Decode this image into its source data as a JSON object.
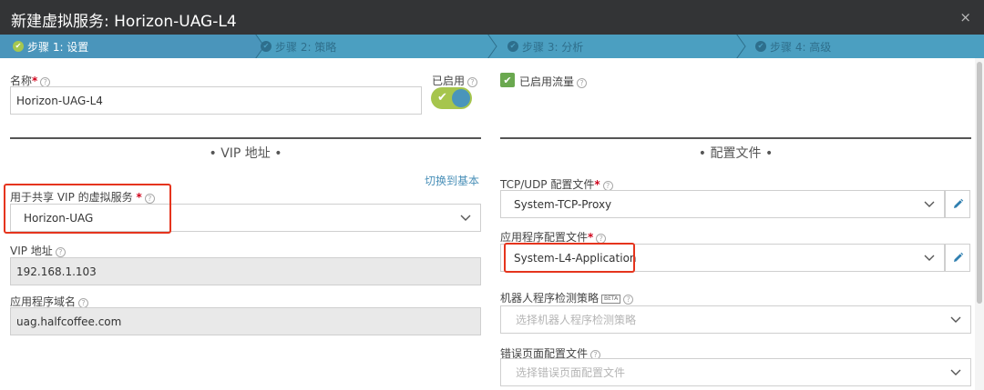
{
  "window": {
    "title": "新建虚拟服务: Horizon-UAG-L4",
    "close_glyph": "×"
  },
  "steps": [
    {
      "label": "步骤 1: 设置",
      "state": "active"
    },
    {
      "label": "步骤 2: 策略",
      "state": "inactive"
    },
    {
      "label": "步骤 3: 分析",
      "state": "inactive"
    },
    {
      "label": "步骤 4: 高级",
      "state": "inactive"
    }
  ],
  "left": {
    "name_label": "名称",
    "name_value": "Horizon-UAG-L4",
    "enabled_label": "已启用",
    "enabled": true,
    "vip_section_title": "• VIP 地址 •",
    "switch_link": "切换到基本",
    "shared_vip_label": "用于共享 VIP 的虚拟服务",
    "shared_vip_value": "Horizon-UAG",
    "vip_address_label": "VIP 地址",
    "vip_address_value": "192.168.1.103",
    "app_domain_label": "应用程序域名",
    "app_domain_value": "uag.halfcoffee.com"
  },
  "right": {
    "traffic_enabled_label": "已启用流量",
    "traffic_enabled": true,
    "profile_section_title": "• 配置文件 •",
    "tcp_udp_label": "TCP/UDP 配置文件",
    "tcp_udp_value": "System-TCP-Proxy",
    "app_profile_label": "应用程序配置文件",
    "app_profile_value": "System-L4-Application",
    "bot_label": "机器人程序检测策略",
    "bot_badge": "BETA",
    "bot_placeholder": "选择机器人程序检测策略",
    "error_page_label": "错误页面配置文件",
    "error_page_placeholder": "选择错误页面配置文件"
  },
  "common": {
    "required_mark": "*",
    "help_glyph": "?",
    "check_glyph": "✔"
  },
  "colors": {
    "titlebar": "#333436",
    "steps_bar": "#4b9fc1",
    "active_step": "#4a95bb",
    "toggle_on": "#a6c54d",
    "highlight": "#e5341d",
    "link": "#4a90b8"
  }
}
